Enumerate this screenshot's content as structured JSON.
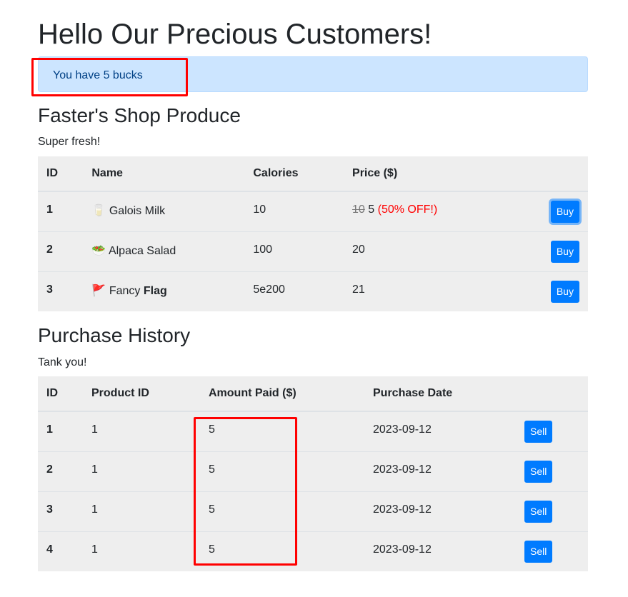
{
  "page": {
    "title": "Hello Our Precious Customers!",
    "balance_text": "You have 5 bucks"
  },
  "shop": {
    "title": "Faster's Shop Produce",
    "subtitle": "Super fresh!",
    "columns": [
      "ID",
      "Name",
      "Calories",
      "Price ($)"
    ],
    "products": [
      {
        "id": "1",
        "icon": "🥛",
        "name": "Galois Milk",
        "name_bold": "",
        "calories": "10",
        "price_old": "10",
        "price": "5",
        "discount": "(50% OFF!)",
        "button": "Buy"
      },
      {
        "id": "2",
        "icon": "🥗",
        "name": "Alpaca Salad",
        "name_bold": "",
        "calories": "100",
        "price_old": "",
        "price": "20",
        "discount": "",
        "button": "Buy"
      },
      {
        "id": "3",
        "icon": "🚩",
        "name": "Fancy",
        "name_bold": "Flag",
        "calories": "5e200",
        "price_old": "",
        "price": "21",
        "discount": "",
        "button": "Buy"
      }
    ]
  },
  "history": {
    "title": "Purchase History",
    "subtitle": "Tank you!",
    "columns": [
      "ID",
      "Product ID",
      "Amount Paid ($)",
      "Purchase Date"
    ],
    "rows": [
      {
        "id": "1",
        "product_id": "1",
        "amount": "5",
        "date": "2023-09-12",
        "button": "Sell"
      },
      {
        "id": "2",
        "product_id": "1",
        "amount": "5",
        "date": "2023-09-12",
        "button": "Sell"
      },
      {
        "id": "3",
        "product_id": "1",
        "amount": "5",
        "date": "2023-09-12",
        "button": "Sell"
      },
      {
        "id": "4",
        "product_id": "1",
        "amount": "5",
        "date": "2023-09-12",
        "button": "Sell"
      }
    ]
  },
  "colors": {
    "primary": "#007bff",
    "alert_bg": "#cce5ff",
    "alert_text": "#004085",
    "annotation": "#ff0000",
    "table_bg": "#eeeeee"
  }
}
